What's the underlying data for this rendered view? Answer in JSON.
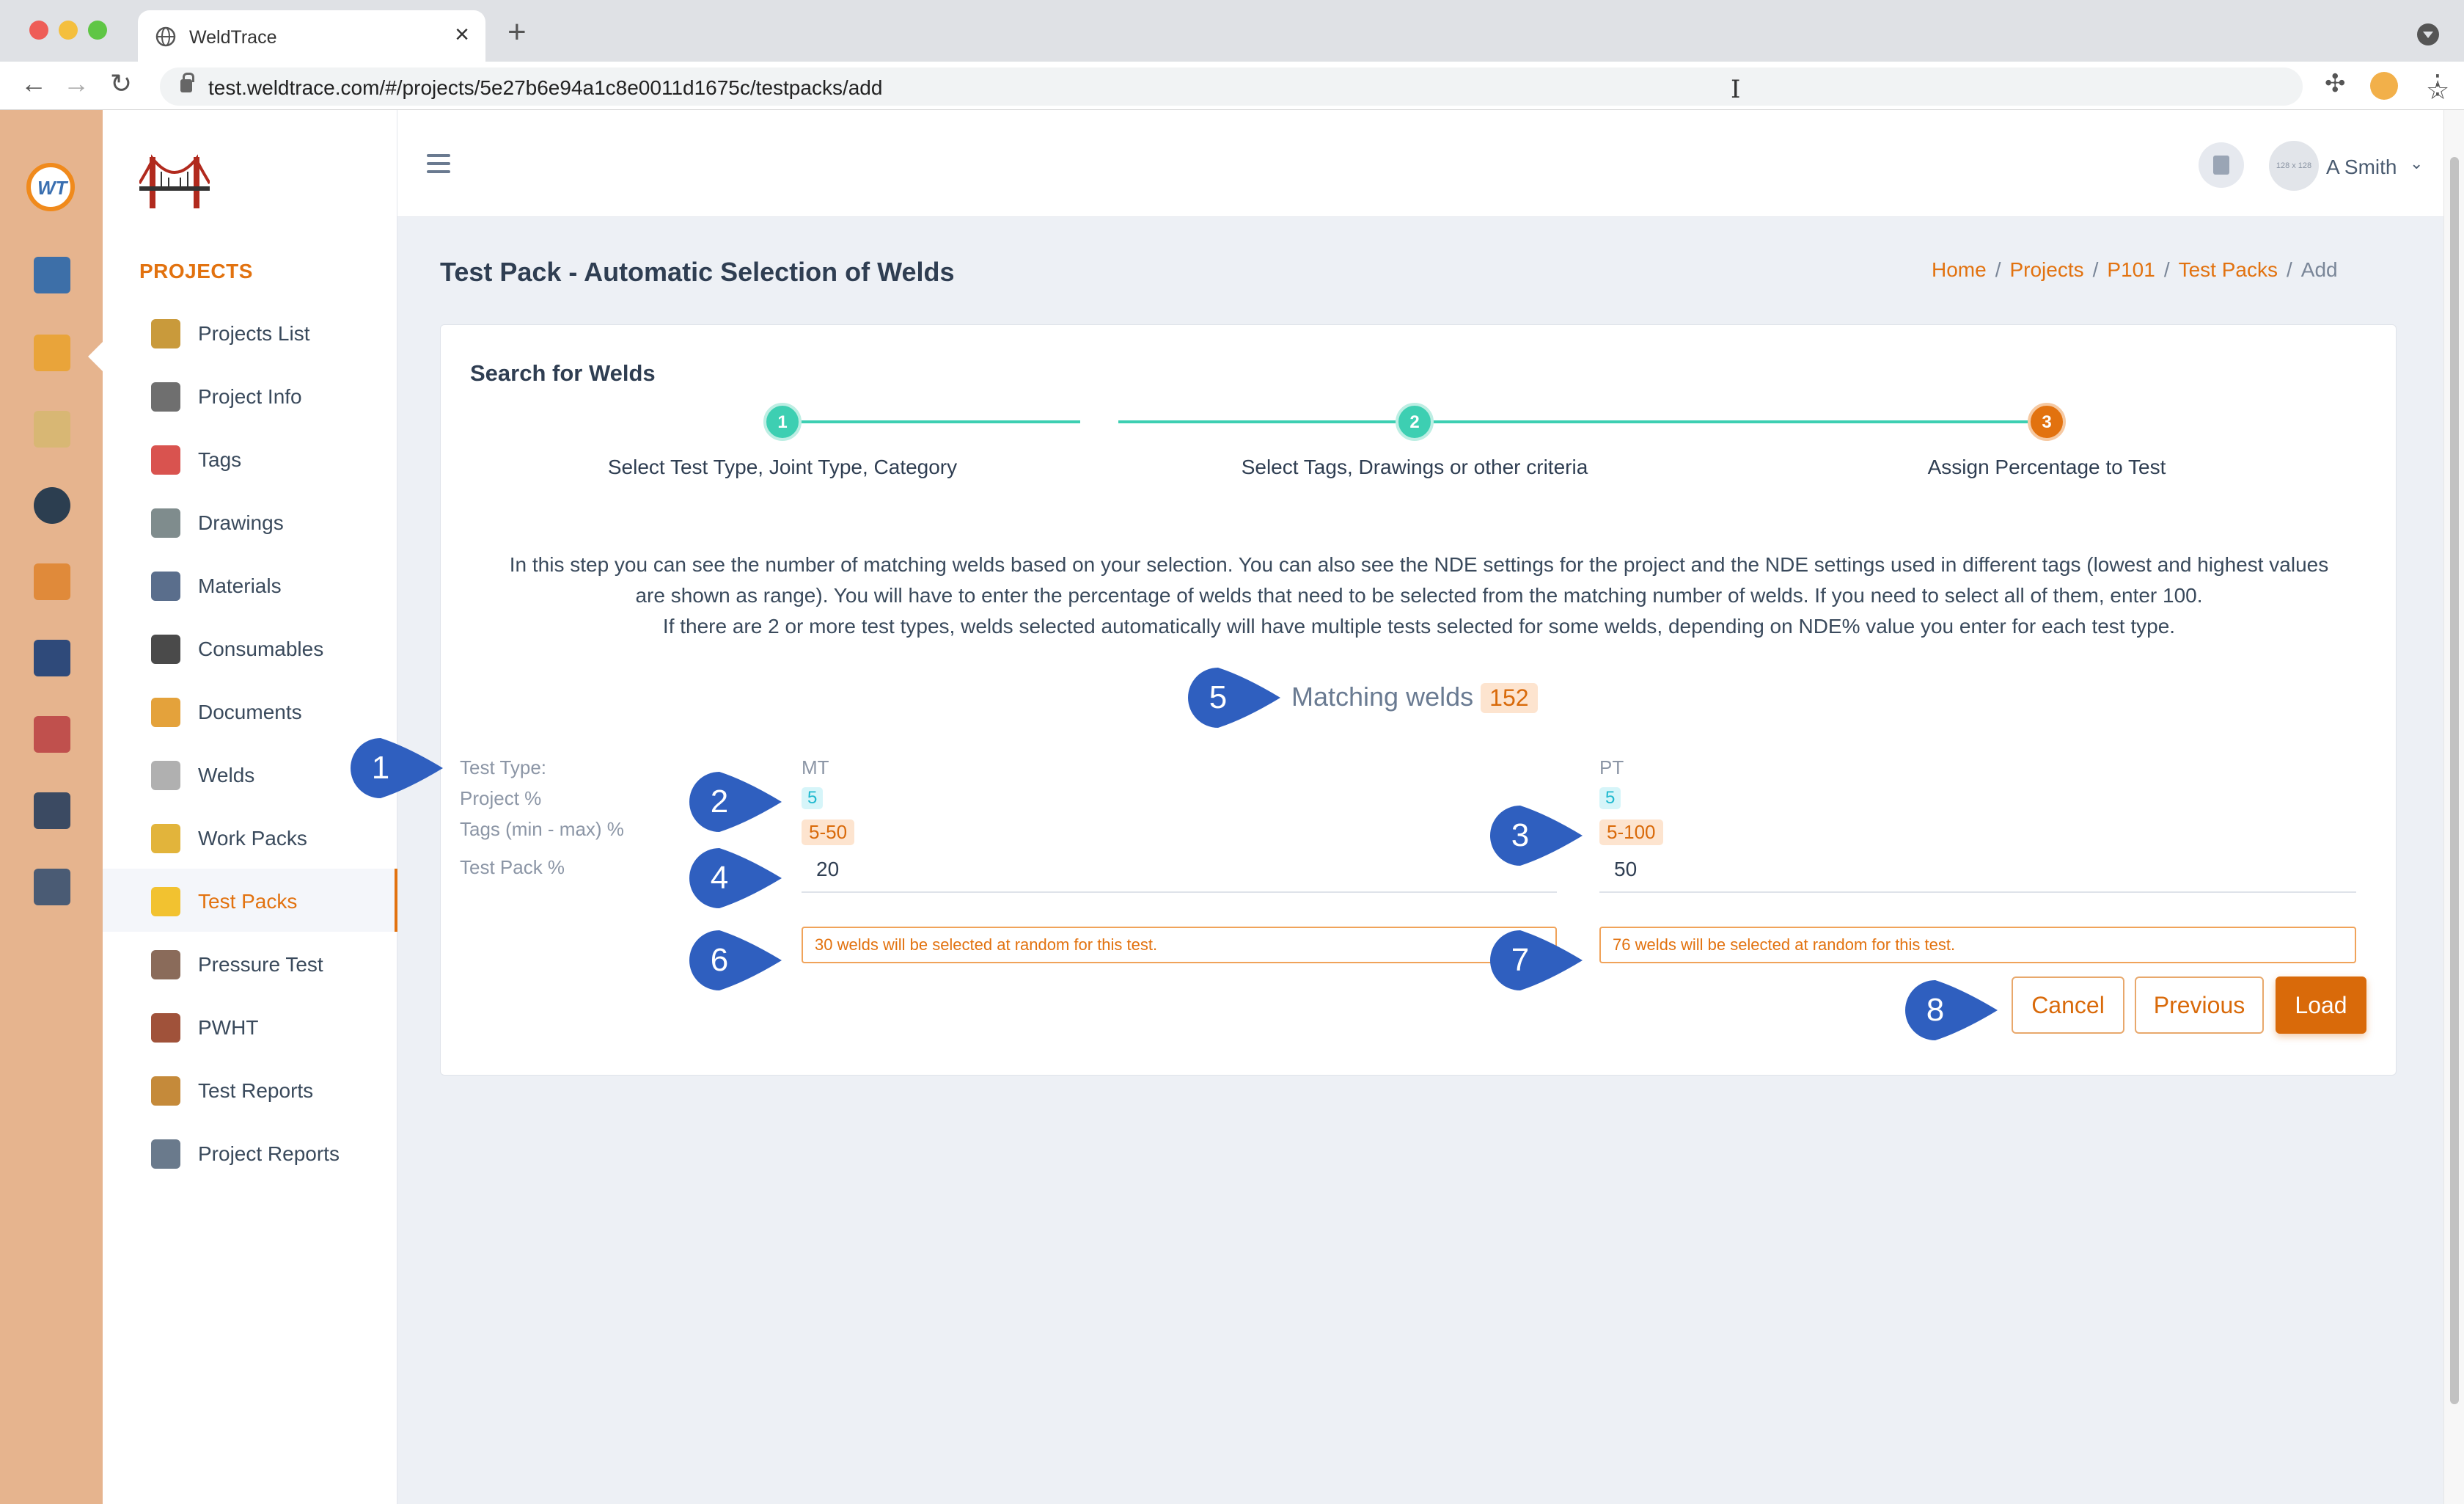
{
  "browser": {
    "tab_title": "WeldTrace",
    "new_tab": "+",
    "close": "×",
    "url": "test.weldtrace.com/#/projects/5e27b6e94a1c8e0011d1675c/testpacks/add",
    "back": "←",
    "forward": "→",
    "reload": "↻",
    "star": "☆",
    "extensions": "✣",
    "menu": "⋮"
  },
  "rail": {
    "logo_text": "WT",
    "icons": [
      "monitor-icon",
      "folder-settings-icon",
      "clipboard-gear-icon",
      "welder-icon",
      "org-chart-icon",
      "book-icon",
      "team-icon",
      "clipboard-clock-icon",
      "id-badge-icon"
    ]
  },
  "sidebar": {
    "section_title": "PROJECTS",
    "items": [
      {
        "label": "Projects List",
        "icon": "camera-folder-icon",
        "color": "#c99a3b"
      },
      {
        "label": "Project Info",
        "icon": "gears-icon",
        "color": "#6f6f6f"
      },
      {
        "label": "Tags",
        "icon": "tag-icon",
        "color": "#d9534f"
      },
      {
        "label": "Drawings",
        "icon": "drafting-icon",
        "color": "#7f8c8d"
      },
      {
        "label": "Materials",
        "icon": "pipes-icon",
        "color": "#5a6e8c"
      },
      {
        "label": "Consumables",
        "icon": "spool-icon",
        "color": "#4a4a4a"
      },
      {
        "label": "Documents",
        "icon": "documents-icon",
        "color": "#e4a23b"
      },
      {
        "label": "Welds",
        "icon": "weld-spark-icon",
        "color": "#b0b0b0"
      },
      {
        "label": "Work Packs",
        "icon": "work-pack-icon",
        "color": "#e2b43b"
      },
      {
        "label": "Test Packs",
        "icon": "radiation-icon",
        "color": "#f2c230"
      },
      {
        "label": "Pressure Test",
        "icon": "pressure-gauge-icon",
        "color": "#8a6b5a"
      },
      {
        "label": "PWHT",
        "icon": "heater-coil-icon",
        "color": "#a0523a"
      },
      {
        "label": "Test Reports",
        "icon": "report-list-icon",
        "color": "#c58a3a"
      },
      {
        "label": "Project Reports",
        "icon": "report-chart-icon",
        "color": "#6a7a8c"
      }
    ],
    "active_item": "Test Packs"
  },
  "topbar": {
    "avatar_text": "128 x 128",
    "username": "A Smith",
    "chevron": "⌄"
  },
  "page": {
    "title": "Test Pack - Automatic Selection of Welds",
    "breadcrumb": [
      "Home",
      "Projects",
      "P101",
      "Test Packs"
    ],
    "breadcrumb_current": "Add",
    "breadcrumb_sep": "/"
  },
  "wizard": {
    "card_title": "Search for Welds",
    "steps": [
      {
        "number": "1",
        "label": "Select Test Type, Joint Type, Category",
        "state": "done"
      },
      {
        "number": "2",
        "label": "Select Tags, Drawings or other criteria",
        "state": "done"
      },
      {
        "number": "3",
        "label": "Assign Percentage to Test",
        "state": "current"
      }
    ],
    "instructions": [
      "In this step you can see the number of matching welds based on your selection. You can also see the NDE settings for the project and the NDE settings used in different tags (lowest and highest values are shown as range). You will have to enter the percentage of welds that need to be selected from the matching number of welds. If you need to select all of them, enter 100.",
      "If there are 2 or more test types, welds selected automatically will have multiple tests selected for some welds, depending on NDE% value you enter for each test type."
    ],
    "matching_label": "Matching welds",
    "matching_count": "152",
    "row_labels": {
      "test_type": "Test Type:",
      "project_pct": "Project %",
      "tags_range": "Tags (min - max) %",
      "test_pack_pct": "Test Pack %"
    },
    "tests": [
      {
        "type": "MT",
        "project_pct": "5",
        "tags_range": "5-50",
        "test_pack_pct": "20",
        "message": "30 welds will be selected at random for this test."
      },
      {
        "type": "PT",
        "project_pct": "5",
        "tags_range": "5-100",
        "test_pack_pct": "50",
        "message": "76 welds will be selected at random for this test."
      }
    ],
    "buttons": {
      "cancel": "Cancel",
      "previous": "Previous",
      "load": "Load"
    }
  },
  "callouts": [
    "1",
    "2",
    "3",
    "4",
    "5",
    "6",
    "7",
    "8"
  ],
  "colors": {
    "accent": "#e2720f",
    "step_done": "#3dcfb2",
    "callout": "#2f5fbf",
    "rail": "#e6b48e"
  }
}
